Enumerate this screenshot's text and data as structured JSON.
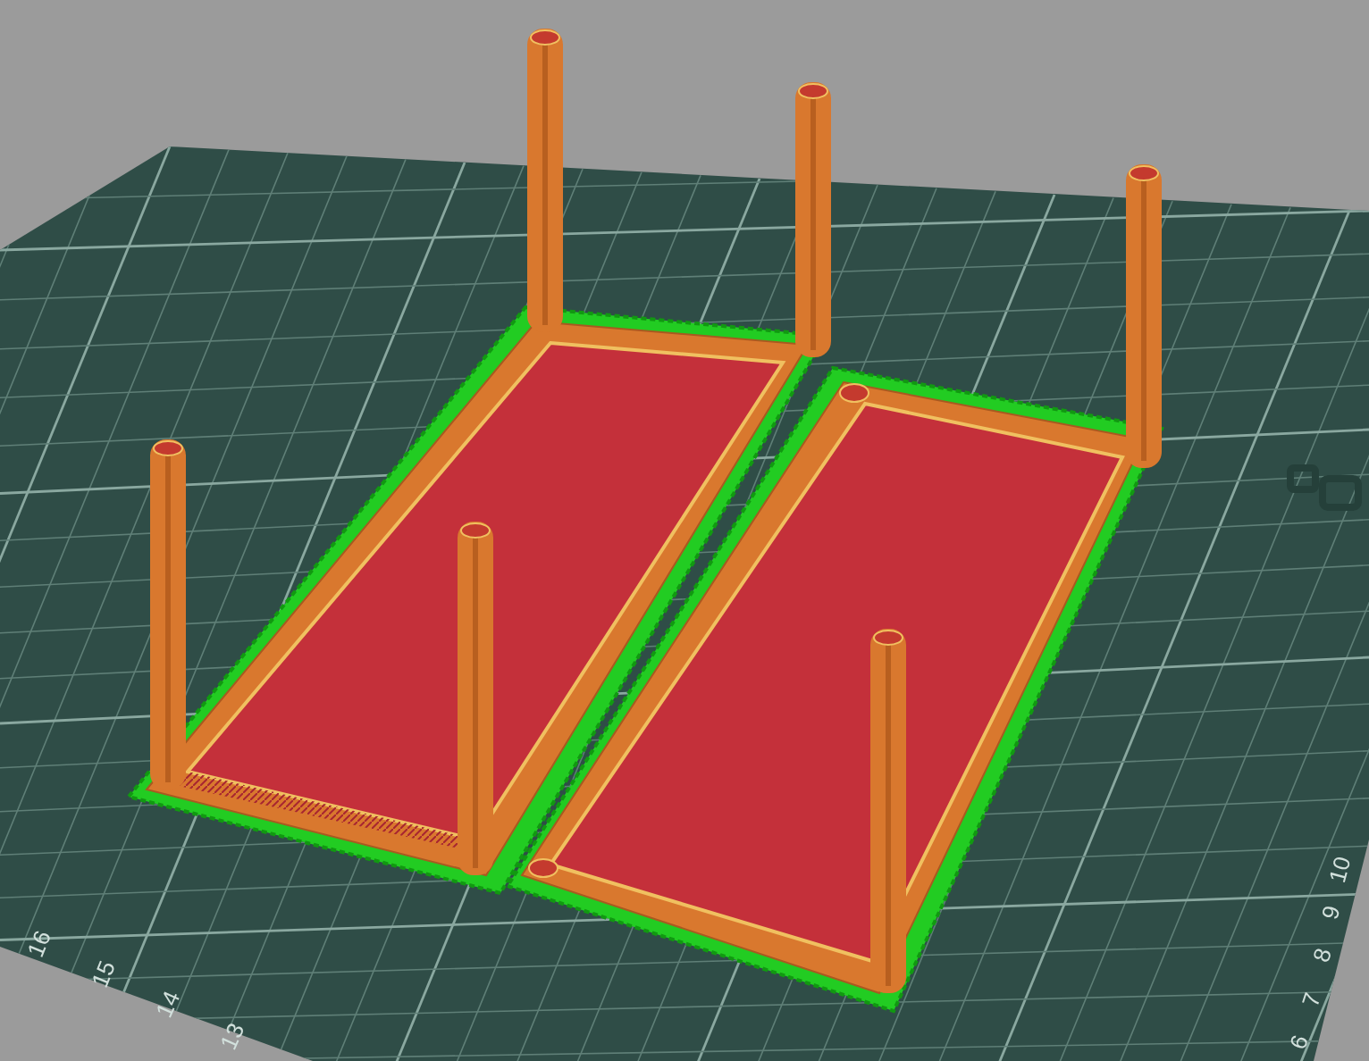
{
  "viewport": {
    "bed_labels": [
      {
        "text": "16"
      },
      {
        "text": "15"
      },
      {
        "text": "14"
      },
      {
        "text": "13"
      },
      {
        "text": "10"
      },
      {
        "text": "9"
      },
      {
        "text": "8"
      },
      {
        "text": "7"
      },
      {
        "text": "6"
      }
    ]
  }
}
